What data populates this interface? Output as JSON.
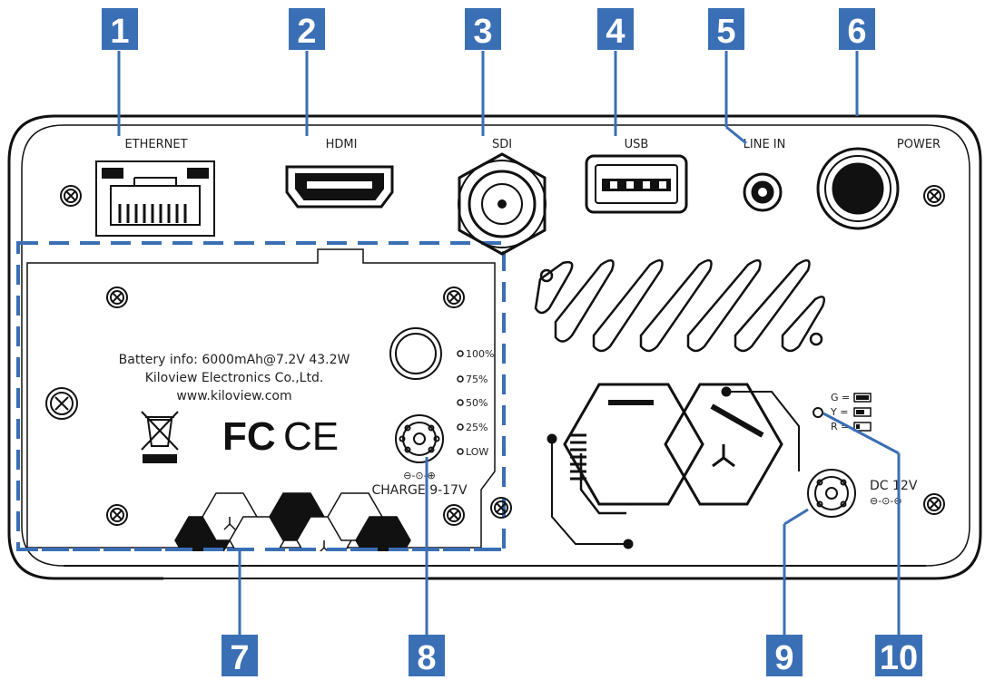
{
  "colors": {
    "accent": "#3a6fb5",
    "outline": "#111111",
    "background": "#ffffff"
  },
  "callouts": [
    {
      "number": "1"
    },
    {
      "number": "2"
    },
    {
      "number": "3"
    },
    {
      "number": "4"
    },
    {
      "number": "5"
    },
    {
      "number": "6"
    },
    {
      "number": "7"
    },
    {
      "number": "8"
    },
    {
      "number": "9"
    },
    {
      "number": "10"
    }
  ],
  "ports": {
    "ethernet": "ETHERNET",
    "hdmi": "HDMI",
    "sdi": "SDI",
    "usb": "USB",
    "line_in": "LINE IN",
    "power": "POWER"
  },
  "battery": {
    "info": "Battery info: 6000mAh@7.2V 43.2W",
    "company": "Kiloview Electronics Co.,Ltd.",
    "website": "www.kiloview.com",
    "levels": [
      "100%",
      "75%",
      "50%",
      "25%",
      "LOW"
    ],
    "charge_label": "CHARGE 9-17V",
    "polarity": "⊖-⊙-⊕"
  },
  "certifications": {
    "fcc": "FC",
    "ce": "CE"
  },
  "dc_input": {
    "label": "DC 12V",
    "polarity": "⊖-⊙-⊕"
  },
  "status_legend": [
    {
      "key": "G ="
    },
    {
      "key": "Y ="
    },
    {
      "key": "R ="
    }
  ]
}
